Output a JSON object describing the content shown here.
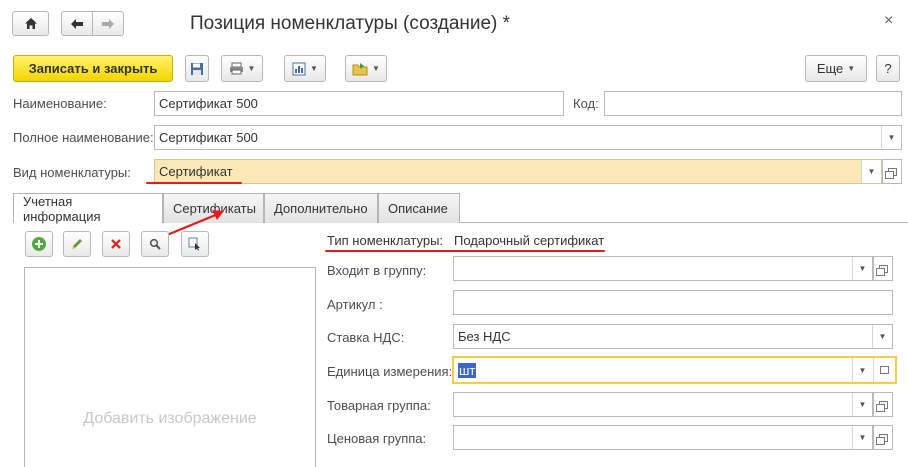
{
  "window": {
    "title": "Позиция номенклатуры (создание) *",
    "close_glyph": "×",
    "nav": {
      "home_icon": "home-icon",
      "back_icon": "arrow-left-icon",
      "forward_icon": "arrow-right-icon"
    }
  },
  "toolbar": {
    "save_close_label": "Записать и закрыть",
    "more_label": "Еще",
    "help_label": "?"
  },
  "fields": {
    "name": {
      "label": "Наименование:",
      "value": "Сертификат 500"
    },
    "code": {
      "label": "Код:",
      "value": ""
    },
    "full_name": {
      "label": "Полное наименование:",
      "value": "Сертификат 500"
    },
    "item_kind": {
      "label": "Вид номенклатуры:",
      "value": "Сертификат"
    }
  },
  "tabs": [
    {
      "label": "Учетная информация",
      "active": true
    },
    {
      "label": "Сертификаты",
      "active": false
    },
    {
      "label": "Дополнительно",
      "active": false
    },
    {
      "label": "Описание",
      "active": false
    }
  ],
  "image_panel": {
    "placeholder": "Добавить изображение"
  },
  "accounting": {
    "item_type": {
      "label": "Тип номенклатуры:",
      "value": "Подарочный сертификат"
    },
    "group": {
      "label": "Входит в группу:",
      "value": ""
    },
    "article": {
      "label": "Артикул :",
      "value": ""
    },
    "vat_rate": {
      "label": "Ставка НДС:",
      "value": "Без НДС"
    },
    "unit": {
      "label": "Единица измерения:",
      "value": "шт"
    },
    "product_group": {
      "label": "Товарная группа:",
      "value": ""
    },
    "price_group": {
      "label": "Ценовая группа:",
      "value": ""
    }
  },
  "colors": {
    "primary_button": "#f5d400",
    "highlight_field": "#fbe8b7",
    "annotation_red": "#e31b1b",
    "selection": "#3c67c7"
  }
}
